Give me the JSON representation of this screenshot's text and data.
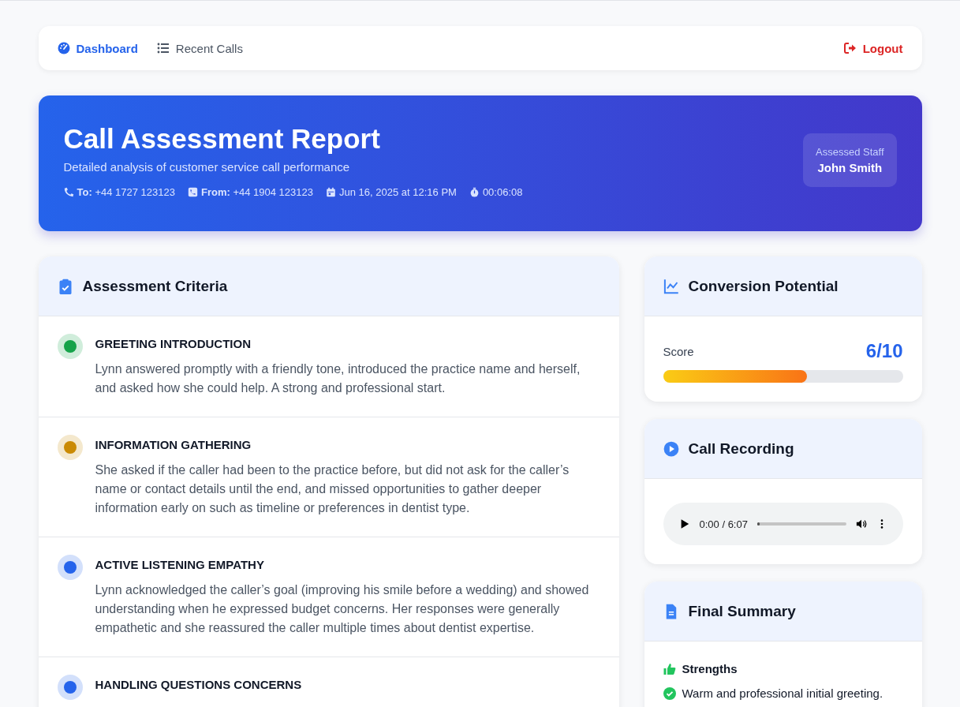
{
  "nav": {
    "items": [
      {
        "label": "Dashboard",
        "selected": true
      },
      {
        "label": "Recent Calls",
        "selected": false
      }
    ],
    "logout": "Logout"
  },
  "header": {
    "title": "Call Assessment Report",
    "subtitle": "Detailed analysis of customer service call performance",
    "meta": [
      {
        "label": "To:",
        "value": "+44 1727 123123"
      },
      {
        "label": "From:",
        "value": "+44 1904 123123"
      },
      {
        "value": "Jun 16, 2025 at 12:16 PM"
      },
      {
        "value": "00:06:08"
      }
    ],
    "staff_label": "Assessed Staff",
    "staff_name": "John Smith"
  },
  "criteria": {
    "title": "Assessment Criteria",
    "items": [
      {
        "name": "GREETING INTRODUCTION",
        "color": "#16a34a",
        "text": "Lynn answered promptly with a friendly tone, introduced the practice name and herself, and asked how she could help. A strong and professional start."
      },
      {
        "name": "INFORMATION GATHERING",
        "color": "#ca8a04",
        "text": "She asked if the caller had been to the practice before, but did not ask for the caller’s name or contact details until the end, and missed opportunities to gather deeper information early on such as timeline or preferences in dentist type."
      },
      {
        "name": "ACTIVE LISTENING EMPATHY",
        "color": "#2563eb",
        "text": "Lynn acknowledged the caller’s goal (improving his smile before a wedding) and showed understanding when he expressed budget concerns. Her responses were generally empathetic and she reassured the caller multiple times about dentist expertise."
      },
      {
        "name": "HANDLING QUESTIONS CONCERNS",
        "color": "#2563eb"
      }
    ]
  },
  "conversion": {
    "title": "Conversion Potential",
    "label": "Score",
    "score": "6/10",
    "level": 0.6
  },
  "recording": {
    "title": "Call Recording",
    "time": "0:00 / 6:07",
    "level": 0.0
  },
  "summary": {
    "title": "Final Summary",
    "strengths_title": "Strengths",
    "strengths": [
      "Warm and professional initial greeting."
    ]
  }
}
